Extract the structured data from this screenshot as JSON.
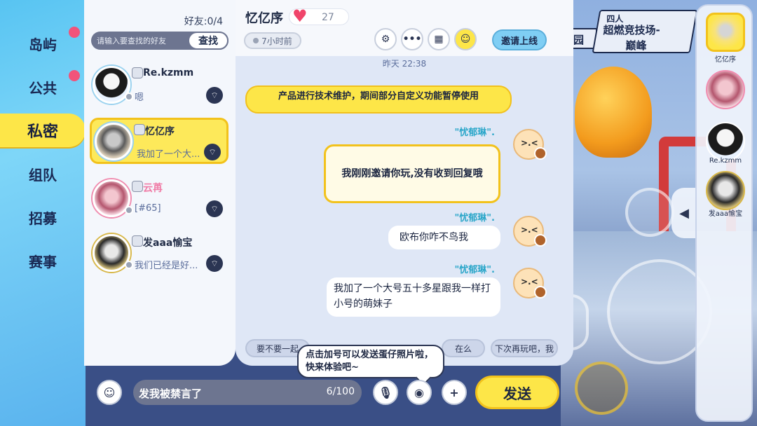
{
  "nav": {
    "items": [
      {
        "label": "岛屿",
        "dot": true
      },
      {
        "label": "公共",
        "dot": true
      },
      {
        "label": "私密",
        "dot": false,
        "active": true
      },
      {
        "label": "组队",
        "dot": false
      },
      {
        "label": "招募",
        "dot": false
      },
      {
        "label": "赛事",
        "dot": false
      }
    ]
  },
  "friends": {
    "count_label": "好友:0/4",
    "search_placeholder": "请输入要查找的好友",
    "search_button": "查找",
    "list": [
      {
        "name": "Re.kzmm",
        "message": "嗯",
        "active": false
      },
      {
        "name": "忆亿序",
        "message": "我加了一个大...",
        "active": true
      },
      {
        "name": "云苒",
        "message": "[#65]",
        "active": false
      },
      {
        "name": "发aaa愉宝",
        "message": "我们已经是好...",
        "active": false
      }
    ]
  },
  "chat": {
    "title": "忆亿序",
    "intimacy": "27",
    "last_seen": "7小时前",
    "invite_button": "邀请上线",
    "timestamp": "昨天 22:38",
    "notice": "产品进行技术维护，期间部分自定义功能暂停使用",
    "sender_name": "\"忧郁琳\".",
    "messages": [
      {
        "text": "我刚刚邀请你玩,没有收到回复哦",
        "style": "invite"
      },
      {
        "text": "欧布你咋不鸟我",
        "style": "normal"
      },
      {
        "text": "我加了一个大号五十多星跟我一样打小号的萌妹子",
        "style": "normal"
      }
    ],
    "quick_replies": [
      "要不要一起",
      "在么",
      "下次再玩吧，我"
    ],
    "tooltip": "点击加号可以发送蛋仔照片啦，快来体验吧~"
  },
  "input": {
    "value": "发我被禁言了",
    "char_count": "6/100",
    "send_button": "发送"
  },
  "game": {
    "banner_line1": "四人",
    "banner_line2": "超燃竞技场-",
    "banner_line3": "巅峰",
    "side_sign": "园"
  },
  "rail": {
    "items": [
      {
        "name": "忆亿序",
        "selected": true
      },
      {
        "name": "",
        "selected": false
      },
      {
        "name": "Re.kzmm",
        "selected": false
      },
      {
        "name": "发aaa愉宝",
        "selected": false
      }
    ]
  },
  "colors": {
    "accent_yellow": "#fde648",
    "nav_blue": "#58c4f2",
    "heart": "#f0456a",
    "dot_pink": "#f1537a"
  }
}
